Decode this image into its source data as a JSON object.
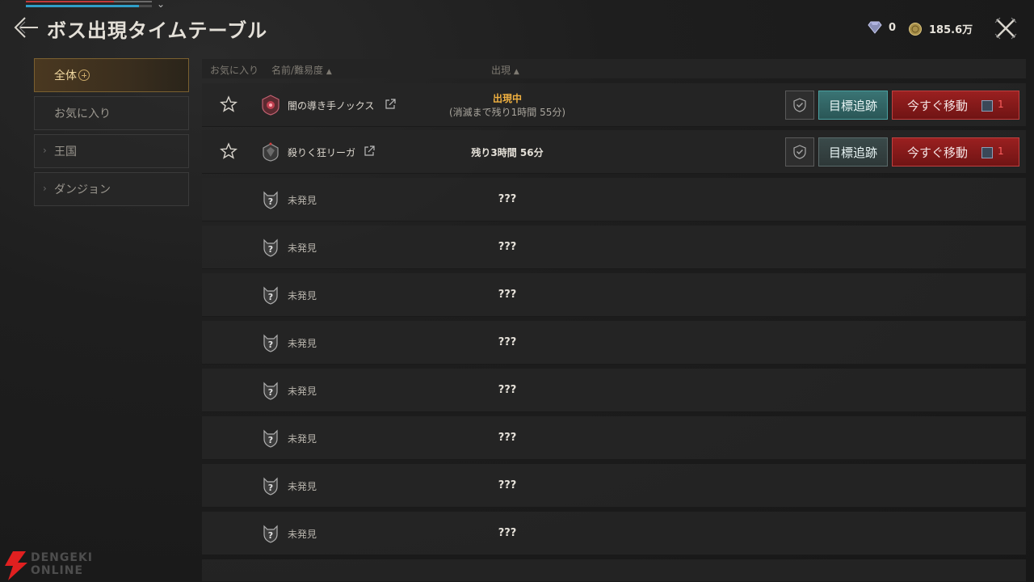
{
  "header": {
    "title": "ボス出現タイムテーブル",
    "diamonds": "0",
    "gold": "185.6万"
  },
  "sidebar": {
    "items": [
      {
        "label": "全体"
      },
      {
        "label": "お気に入り"
      },
      {
        "label": "王国"
      },
      {
        "label": "ダンジョン"
      }
    ]
  },
  "columns": {
    "favorite": "お気に入り",
    "name": "名前/難易度",
    "spawn": "出現"
  },
  "rows": [
    {
      "name": "闇の導き手ノックス",
      "status_main": "出現中",
      "status_sub": "(消滅まで残り1時間 55分)",
      "track_label": "目標追跡",
      "move_label": "今すぐ移動",
      "move_count": "1"
    },
    {
      "name": "殺りく狂リーガ",
      "status_main": "残り3時間 56分",
      "track_label": "目標追跡",
      "move_label": "今すぐ移動",
      "move_count": "1"
    },
    {
      "name": "未発見",
      "status": "???"
    },
    {
      "name": "未発見",
      "status": "???"
    },
    {
      "name": "未発見",
      "status": "???"
    },
    {
      "name": "未発見",
      "status": "???"
    },
    {
      "name": "未発見",
      "status": "???"
    },
    {
      "name": "未発見",
      "status": "???"
    },
    {
      "name": "未発見",
      "status": "???"
    },
    {
      "name": "未発見",
      "status": "???"
    }
  ],
  "watermark": {
    "line1": "DENGEKI",
    "line2": "ONLINE"
  },
  "colors": {
    "active_tab": "#f0d8a0",
    "spawning": "#f0b040",
    "track_btn": "#3a7474",
    "move_btn": "#9a2020"
  }
}
